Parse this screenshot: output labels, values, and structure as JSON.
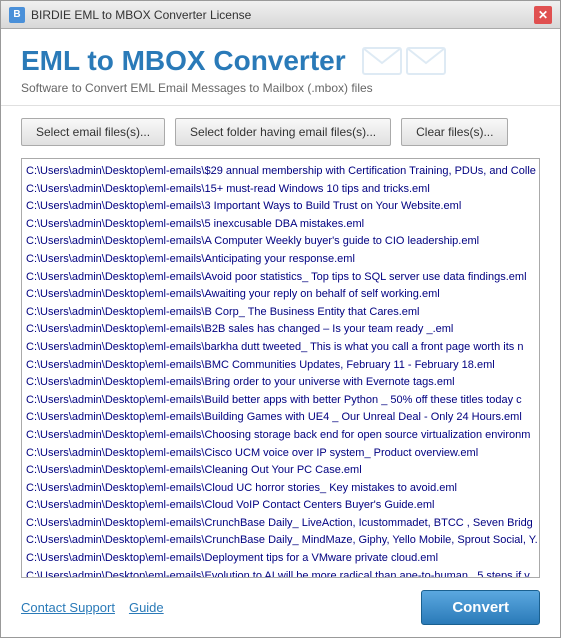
{
  "titleBar": {
    "icon": "B",
    "text": "BIRDIE EML to MBOX Converter License",
    "closeLabel": "✕"
  },
  "header": {
    "title": "EML to MBOX Converter",
    "subtitle": "Software to Convert EML Email Messages to Mailbox (.mbox) files"
  },
  "toolbar": {
    "selectFiles": "Select email files(s)...",
    "selectFolder": "Select folder having email files(s)...",
    "clearFiles": "Clear files(s)..."
  },
  "fileList": {
    "items": [
      "C:\\Users\\admin\\Desktop\\eml-emails\\$29 annual membership with Certification Training, PDUs, and Colle",
      "C:\\Users\\admin\\Desktop\\eml-emails\\15+ must-read Windows 10 tips and tricks.eml",
      "C:\\Users\\admin\\Desktop\\eml-emails\\3 Important Ways to Build Trust on Your Website.eml",
      "C:\\Users\\admin\\Desktop\\eml-emails\\5 inexcusable DBA mistakes.eml",
      "C:\\Users\\admin\\Desktop\\eml-emails\\A Computer Weekly buyer's guide to CIO leadership.eml",
      "C:\\Users\\admin\\Desktop\\eml-emails\\Anticipating your response.eml",
      "C:\\Users\\admin\\Desktop\\eml-emails\\Avoid poor statistics_ Top tips to SQL server use data findings.eml",
      "C:\\Users\\admin\\Desktop\\eml-emails\\Awaiting your reply on behalf of self working.eml",
      "C:\\Users\\admin\\Desktop\\eml-emails\\B Corp_ The Business Entity that Cares.eml",
      "C:\\Users\\admin\\Desktop\\eml-emails\\B2B sales has changed – Is your team ready _.eml",
      "C:\\Users\\admin\\Desktop\\eml-emails\\barkha dutt tweeted_ This is what you call a front page worth its n",
      "C:\\Users\\admin\\Desktop\\eml-emails\\BMC Communities Updates, February 11 - February 18.eml",
      "C:\\Users\\admin\\Desktop\\eml-emails\\Bring order to your universe with Evernote tags.eml",
      "C:\\Users\\admin\\Desktop\\eml-emails\\Build better apps with better Python _ 50% off these titles today c",
      "C:\\Users\\admin\\Desktop\\eml-emails\\Building Games with UE4 _ Our Unreal Deal - Only 24 Hours.eml",
      "C:\\Users\\admin\\Desktop\\eml-emails\\Choosing storage back end for open source virtualization environm",
      "C:\\Users\\admin\\Desktop\\eml-emails\\Cisco UCM voice over IP system_ Product overview.eml",
      "C:\\Users\\admin\\Desktop\\eml-emails\\Cleaning Out Your PC Case.eml",
      "C:\\Users\\admin\\Desktop\\eml-emails\\Cloud UC horror stories_ Key mistakes to avoid.eml",
      "C:\\Users\\admin\\Desktop\\eml-emails\\Cloud VoIP Contact Centers Buyer's Guide.eml",
      "C:\\Users\\admin\\Desktop\\eml-emails\\CrunchBase Daily_ LiveAction, Icustommadet, BTCC , Seven Bridg",
      "C:\\Users\\admin\\Desktop\\eml-emails\\CrunchBase Daily_ MindMaze, Giphy, Yello Mobile, Sprout Social, Y.",
      "C:\\Users\\admin\\Desktop\\eml-emails\\Deployment tips for a VMware private cloud.eml",
      "C:\\Users\\admin\\Desktop\\eml-emails\\Evolution to AI will be more radical than ape-to-human_ 5 steps if v"
    ]
  },
  "footer": {
    "contactSupport": "Contact Support",
    "guide": "Guide",
    "convertBtn": "Convert"
  }
}
